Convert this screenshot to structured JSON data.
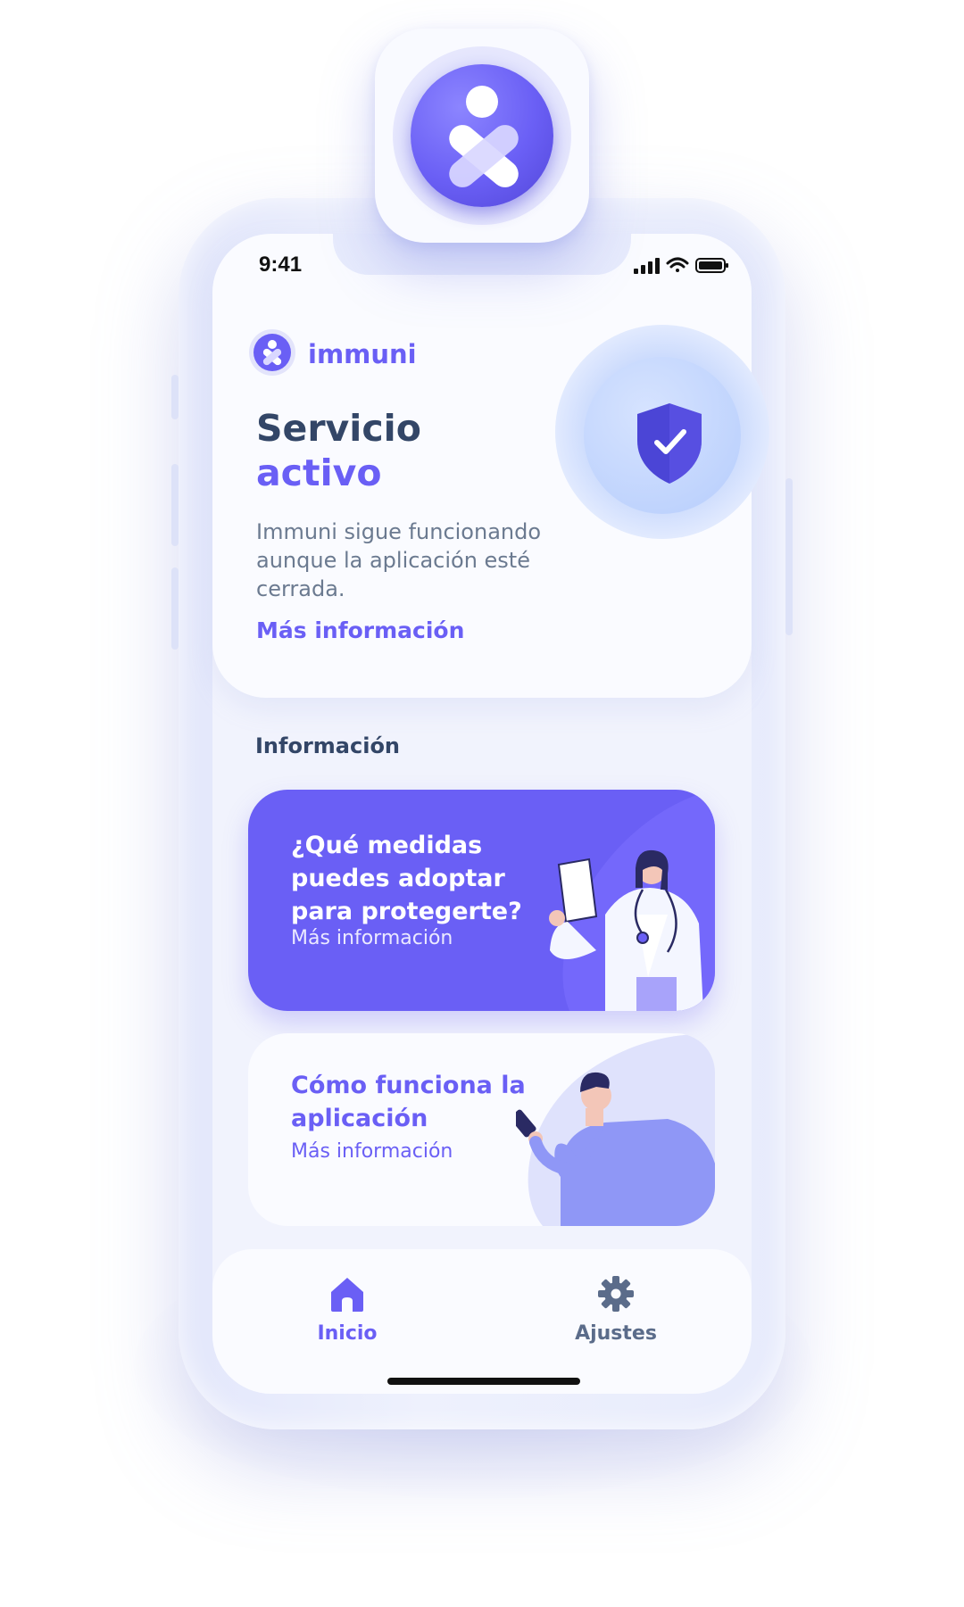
{
  "status_bar": {
    "time": "9:41"
  },
  "header": {
    "brand": "immuni"
  },
  "status_card": {
    "title_line1": "Servicio",
    "title_line2": "activo",
    "description": "Immuni sigue funcionando aunque la aplicación esté cerrada.",
    "link": "Más información"
  },
  "info_section": {
    "title": "Información",
    "cards": [
      {
        "title": "¿Qué medidas puedes adoptar para protegerte?",
        "link": "Más información"
      },
      {
        "title": "Cómo funciona la aplicación",
        "link": "Más información"
      }
    ]
  },
  "tab_bar": {
    "items": [
      {
        "label": "Inicio",
        "icon": "home-icon",
        "active": true
      },
      {
        "label": "Ajustes",
        "icon": "gear-icon",
        "active": false
      }
    ]
  },
  "colors": {
    "accent": "#6a5ff5",
    "heading": "#334667",
    "body_text": "#6b7a90",
    "inactive_tab": "#5b6c8a"
  }
}
